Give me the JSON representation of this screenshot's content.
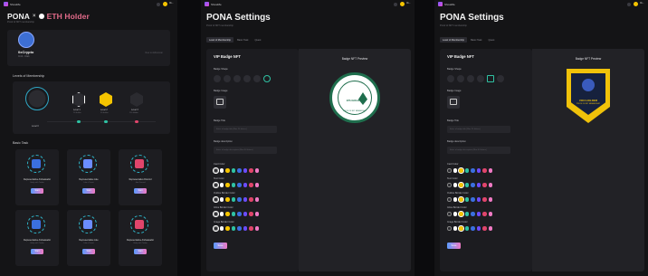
{
  "app": {
    "name": "ShowMe",
    "account_line1": "0x...",
    "account_line2": "0x..."
  },
  "holder": {
    "title_left": "PONA",
    "title_sep": "×",
    "title_right": "ETH Holder",
    "subtitle": "Proof of NFT membership",
    "profile": {
      "name": "0xCrypto",
      "sub": "0x12...34ab",
      "link": "View on Etherscan"
    },
    "levels_title": "Levels of Membership",
    "levels": [
      {
        "label": "Level 0",
        "sub": "0 Holder"
      },
      {
        "label": "Level 1",
        "sub": "10 Holder"
      },
      {
        "label": "Level 2",
        "sub": "50 Holder"
      },
      {
        "label": "Level 3",
        "sub": "100 Holder"
      }
    ],
    "tasks_title": "Basic Task",
    "tasks": [
      {
        "title": "Representative Ambassador",
        "sub": "Verify with Twitter",
        "btn": "Start",
        "color": "#3b6fe0"
      },
      {
        "title": "Representative Like",
        "sub": "Like a Tweet",
        "btn": "Start",
        "color": "#6b8cff"
      },
      {
        "title": "Representative Discord",
        "sub": "Join Discord",
        "btn": "Start",
        "color": "#e0456b"
      },
      {
        "title": "Representative Ambassador",
        "sub": "Verify with Twitter",
        "btn": "Start",
        "color": "#3b6fe0"
      },
      {
        "title": "Representative Like",
        "sub": "Like a Tweet",
        "btn": "Start",
        "color": "#6b8cff"
      },
      {
        "title": "Representative Ambassador",
        "sub": "Verify with Twitter",
        "btn": "Start",
        "color": "#e0456b"
      }
    ]
  },
  "settings": {
    "title": "PONA Settings",
    "subtitle": "Proof of NFT membership",
    "tabs": [
      "Level of Membership",
      "Basic Task",
      "Quest"
    ],
    "form_title": "VIP Badge NFT",
    "preview_title": "Badge NFT Preview",
    "labels": {
      "shape": "Badge Shape",
      "image": "Badge Image",
      "title": "Badge Title",
      "desc": "Badge description",
      "card": "Card Color",
      "text": "Text Color",
      "outline": "Outline Border Color",
      "inline": "Inline Border Color",
      "image_border": "Image Border Color"
    },
    "title_placeholder": "Enter a badge title (Max 20 letters)",
    "desc_placeholder": "Enter a badge description (Max 40 letters)",
    "save": "Save",
    "swatches": [
      "#ffffff",
      "#f5c400",
      "#2fc2a3",
      "#3b6fe0",
      "#6b4cff",
      "#e0456b",
      "#f07ac4",
      "#2ad1e0"
    ],
    "badge_green": {
      "title": "ETH HOLDER",
      "sub": "PROOF OF NFT MEMBERSHIP"
    },
    "badge_gold": {
      "title": "VOO HOLDER",
      "sub": "PROOF OF NFT MEMBERSHIP"
    },
    "colors": {
      "green": "#1f6e4d",
      "gold": "#f0c20a",
      "navy": "#16213d"
    }
  }
}
